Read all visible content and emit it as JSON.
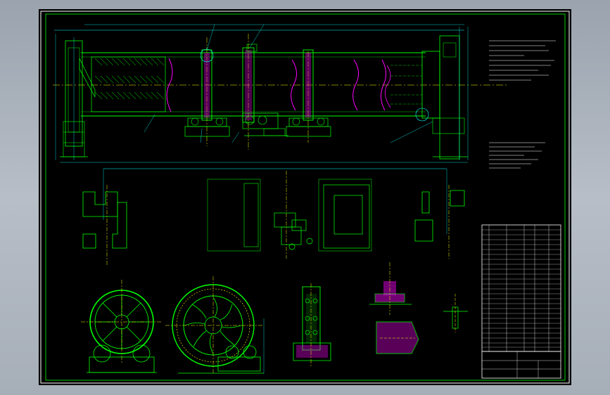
{
  "drawing": {
    "title": "",
    "drawing_number": "",
    "scale": "",
    "tech_requirements_heading_1": "",
    "tech_requirements_heading_2": ""
  },
  "colors": {
    "background": "#000000",
    "frame": "#ffffff",
    "outline": "#00ff00",
    "centerline": "#ffff00",
    "dimension": "#00ffff",
    "hatch": "#ff00ff",
    "sheet_bg": "#a9b1bb"
  },
  "views": [
    "main-elevation",
    "section-a",
    "plan-view-support",
    "plan-view-drive",
    "section-b",
    "end-view-feed",
    "end-view-discharge",
    "detail-roller",
    "detail-seal",
    "detail-small"
  ],
  "parts_table": {
    "row_count": 27
  }
}
